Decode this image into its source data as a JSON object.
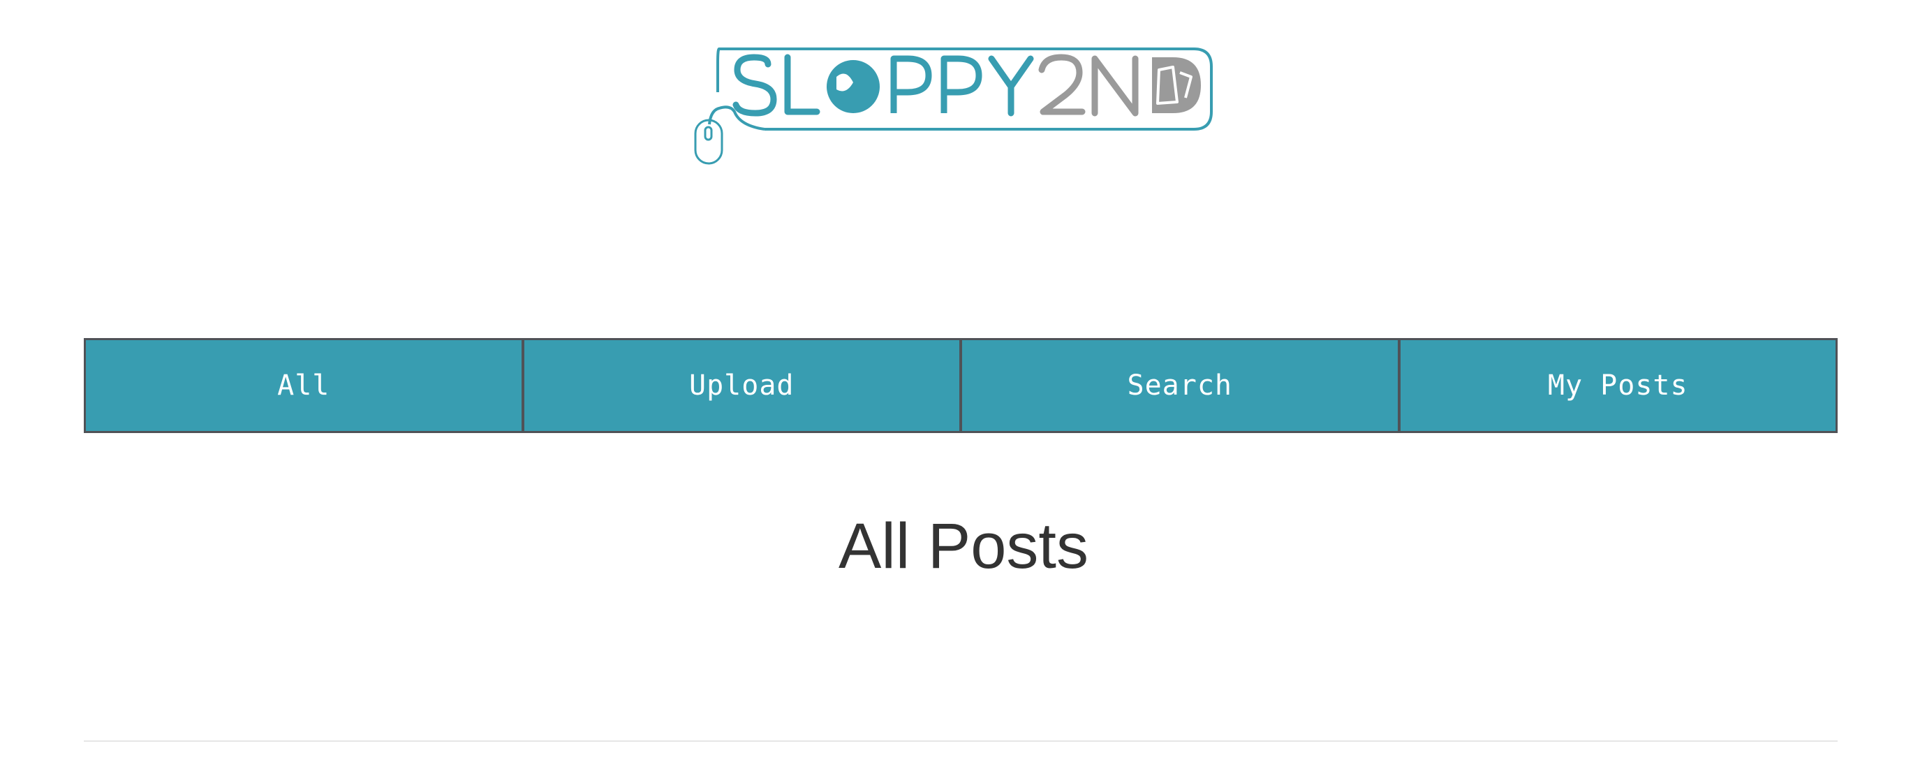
{
  "brand": {
    "logo_text": "SLOPPY2ND",
    "colors": {
      "teal": "#389db1",
      "gray": "#9a9a9a"
    }
  },
  "nav": {
    "items": [
      {
        "label": "All"
      },
      {
        "label": "Upload"
      },
      {
        "label": "Search"
      },
      {
        "label": "My Posts"
      }
    ],
    "background": "#389db1",
    "border": "#505257"
  },
  "main": {
    "title": "All Posts"
  }
}
